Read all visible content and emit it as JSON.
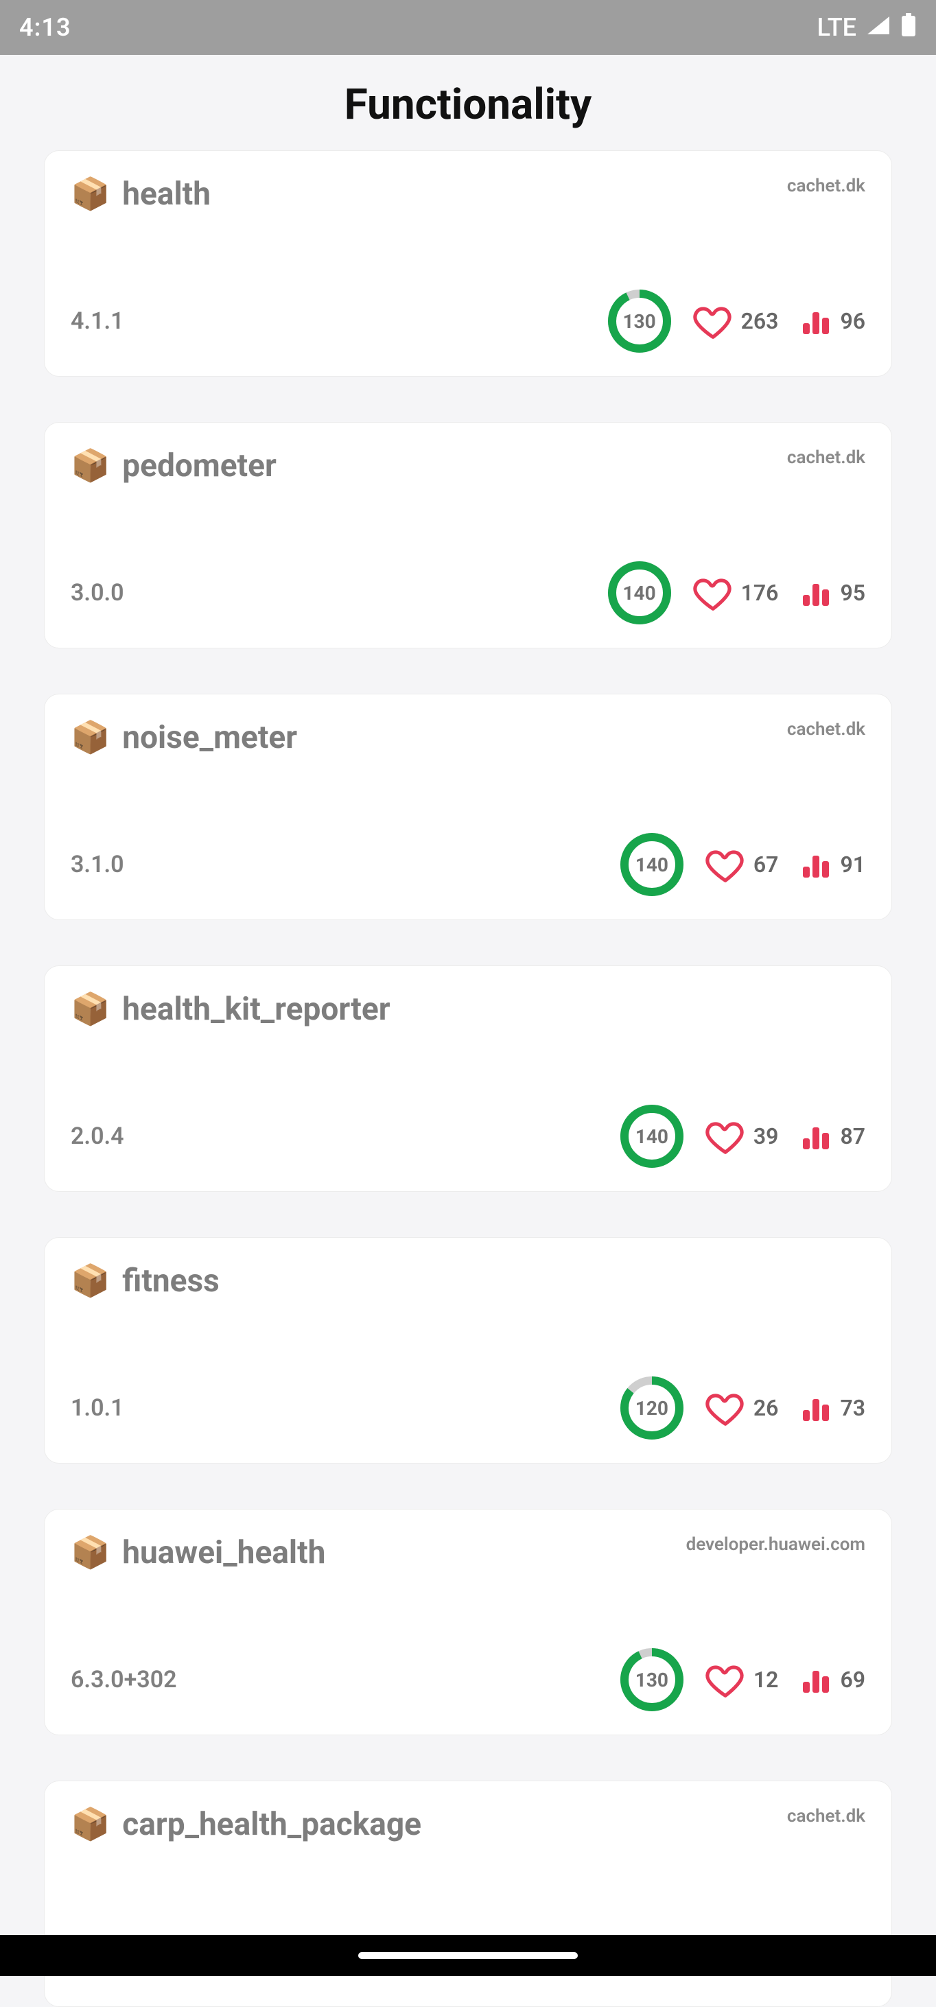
{
  "status": {
    "time": "4:13",
    "network": "LTE"
  },
  "page": {
    "title": "Functionality"
  },
  "accent": {
    "green": "#17A54B",
    "red": "#E63957",
    "grey_ring_bg": "#cfcfcf"
  },
  "packages": [
    {
      "name": "health",
      "publisher": "cachet.dk",
      "version": "4.1.1",
      "score": 130,
      "score_max": 140,
      "likes": 263,
      "popularity": 96
    },
    {
      "name": "pedometer",
      "publisher": "cachet.dk",
      "version": "3.0.0",
      "score": 140,
      "score_max": 140,
      "likes": 176,
      "popularity": 95
    },
    {
      "name": "noise_meter",
      "publisher": "cachet.dk",
      "version": "3.1.0",
      "score": 140,
      "score_max": 140,
      "likes": 67,
      "popularity": 91
    },
    {
      "name": "health_kit_reporter",
      "publisher": "",
      "version": "2.0.4",
      "score": 140,
      "score_max": 140,
      "likes": 39,
      "popularity": 87
    },
    {
      "name": "fitness",
      "publisher": "",
      "version": "1.0.1",
      "score": 120,
      "score_max": 140,
      "likes": 26,
      "popularity": 73
    },
    {
      "name": "huawei_health",
      "publisher": "developer.huawei.com",
      "version": "6.3.0+302",
      "score": 130,
      "score_max": 140,
      "likes": 12,
      "popularity": 69
    },
    {
      "name": "carp_health_package",
      "publisher": "cachet.dk",
      "version": "",
      "score": null,
      "score_max": 140,
      "likes": null,
      "popularity": null
    }
  ]
}
